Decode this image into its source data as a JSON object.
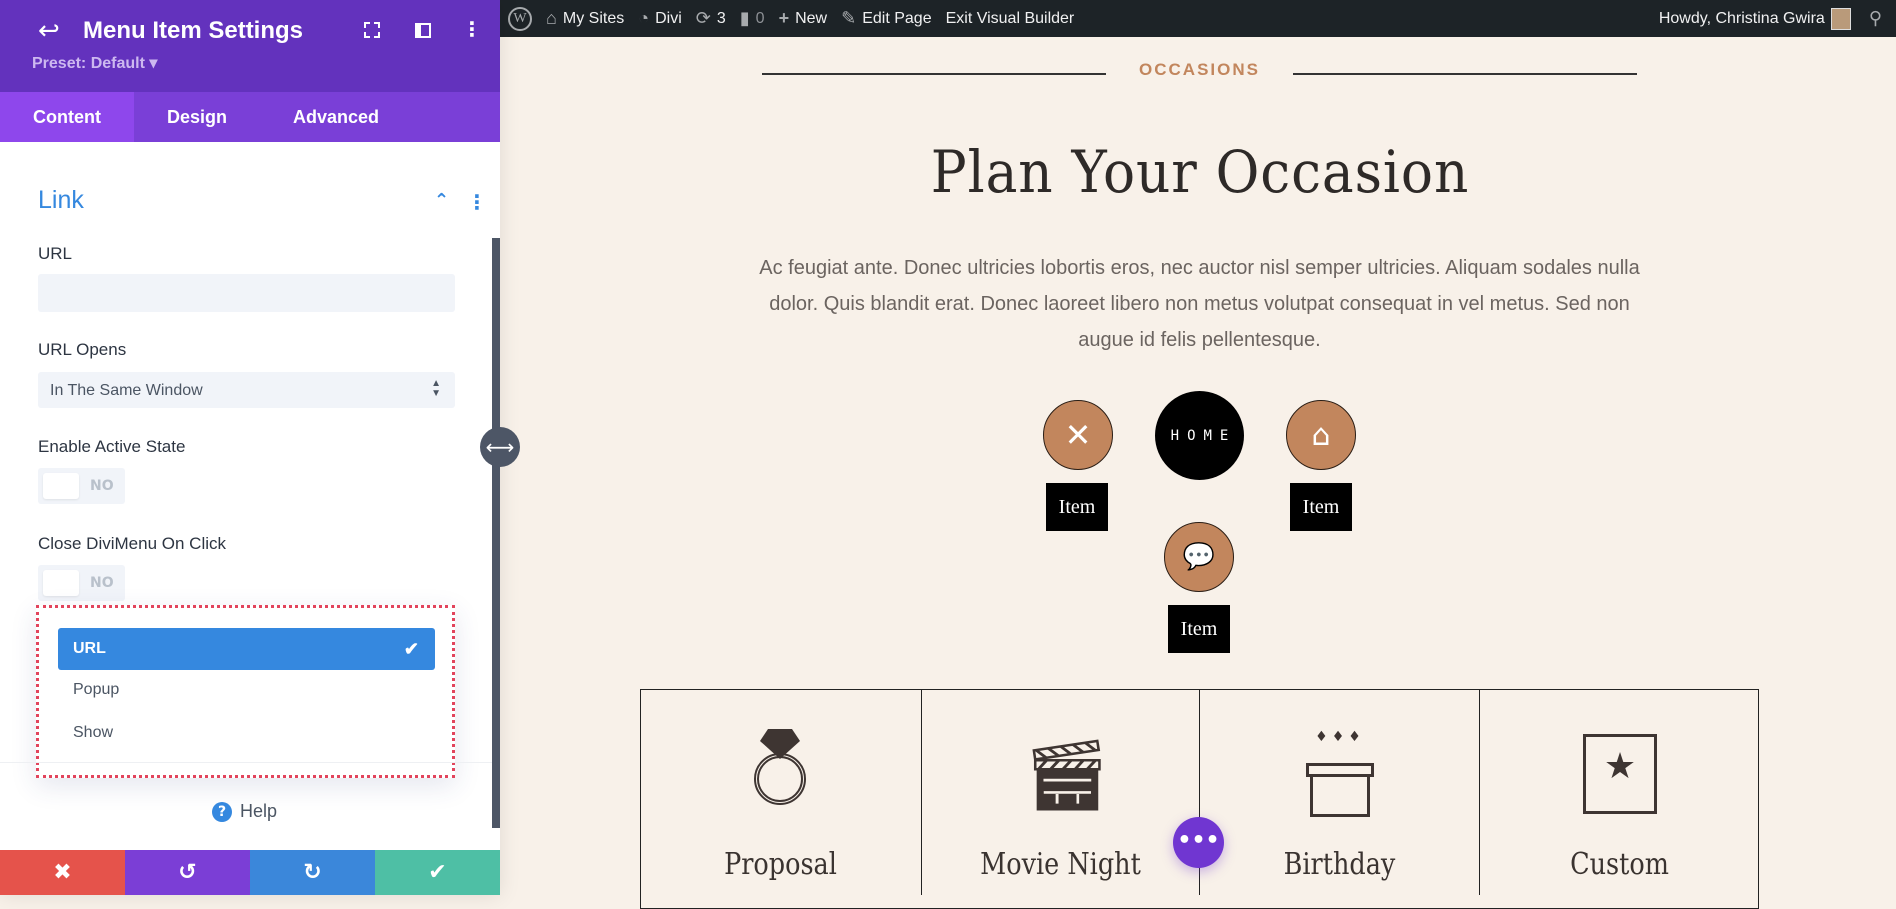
{
  "panel": {
    "title": "Menu Item Settings",
    "preset": "Preset: Default ▾",
    "tabs": [
      {
        "label": "Content",
        "active": true
      },
      {
        "label": "Design"
      },
      {
        "label": "Advanced"
      }
    ],
    "section_title": "Link",
    "url_label": "URL",
    "url_value": "",
    "url_opens_label": "URL Opens",
    "url_opens_value": "In The Same Window",
    "active_state_label": "Enable Active State",
    "active_state_value": "NO",
    "close_menu_label": "Close DiviMenu On Click",
    "close_menu_value": "NO",
    "dropdown_options": [
      {
        "label": "URL",
        "selected": true
      },
      {
        "label": "Popup"
      },
      {
        "label": "Show"
      }
    ],
    "help_label": "Help"
  },
  "admin_bar": {
    "my_sites": "My Sites",
    "divi": "Divi",
    "updates": "3",
    "comments": "0",
    "new": "New",
    "edit_page": "Edit Page",
    "exit_builder": "Exit Visual Builder",
    "howdy": "Howdy, Christina Gwira"
  },
  "page": {
    "eyebrow": "OCCASIONS",
    "heading": "Plan Your Occasion",
    "paragraph": "Ac feugiat ante. Donec ultricies lobortis eros, nec auctor nisl semper ultricies. Aliquam sodales nulla dolor. Quis blandit erat. Donec laoreet libero non metus volutpat consequat in vel metus. Sed non augue id felis pellentesque.",
    "menu_home": "HOME",
    "menu_items": [
      "Item",
      "Item",
      "Item"
    ],
    "cards": [
      "Proposal",
      "Movie Night",
      "Birthday",
      "Custom"
    ]
  },
  "colors": {
    "purple": "#6332bd",
    "accent_blue": "#3588df",
    "cancel": "#e5534b",
    "undo": "#7b3ed6",
    "redo": "#3b87da",
    "save": "#4ebfa5",
    "tan": "#c2865d",
    "cream": "#f8f1e9"
  }
}
